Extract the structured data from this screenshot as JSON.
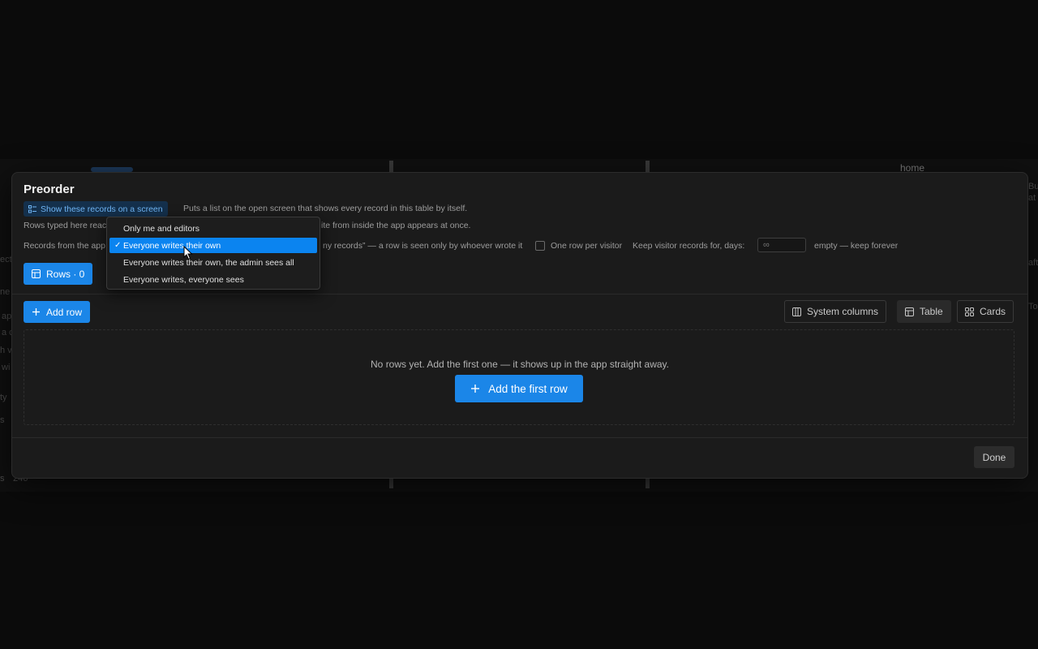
{
  "background": {
    "home_label": "home",
    "fragments": [
      "ect",
      "ne",
      "ap",
      "a c",
      "h v",
      "wi",
      "ty",
      "s",
      "s",
      "246",
      "Bu",
      "at",
      "aft",
      "To"
    ]
  },
  "modal": {
    "title": "Preorder",
    "show_button_label": "Show these records on a screen",
    "show_description": "Puts a list on the open screen that shows every record in this table by itself.",
    "rows_typed_prefix": "Rows typed here reac",
    "rows_typed_suffix": "ite from inside the app appears at once.",
    "records_prefix": "Records from the app",
    "records_middle": "ny records” — a row is seen only by whoever wrote it",
    "one_row_label": "One row per visitor",
    "keep_days_label": "Keep visitor records for, days:",
    "keep_days_value": "∞",
    "keep_days_hint": "empty — keep forever",
    "rows_button_label": "Rows · 0",
    "add_row_label": "Add row",
    "system_columns_label": "System columns",
    "table_label": "Table",
    "cards_label": "Cards",
    "empty_text": "No rows yet. Add the first one — it shows up in the app straight away.",
    "add_first_row_label": "Add the first row",
    "done_label": "Done"
  },
  "dropdown": {
    "options": [
      {
        "label": "Only me and editors",
        "selected": false
      },
      {
        "label": "Everyone writes their own",
        "selected": true
      },
      {
        "label": "Everyone writes their own, the admin sees all",
        "selected": false
      },
      {
        "label": "Everyone writes, everyone sees",
        "selected": false
      }
    ],
    "check_mark": "✓"
  },
  "colors": {
    "accent": "#1b86e8",
    "selected_option": "#0b84f0",
    "modal_bg": "#1b1b1b"
  }
}
